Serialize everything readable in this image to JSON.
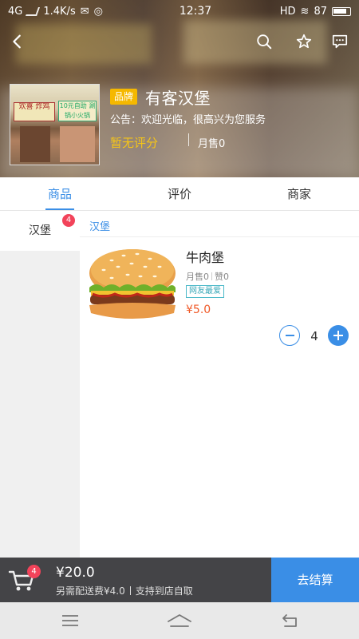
{
  "status_bar": {
    "network": "4G",
    "speed": "1.4K/s",
    "time": "12:37",
    "hd": "HD",
    "battery": "87"
  },
  "shop": {
    "brand_tag": "品牌",
    "name": "有客汉堡",
    "notice": "公告：欢迎光临，很高兴为您服务",
    "rating": "暂无评分",
    "monthly_sales": "月售0",
    "thumb_sign_left": "欢喜 炸鸡",
    "thumb_sign_right": "10元自助 涮锅小火锅"
  },
  "tabs": [
    {
      "label": "商品",
      "active": true
    },
    {
      "label": "评价",
      "active": false
    },
    {
      "label": "商家",
      "active": false
    }
  ],
  "categories": [
    {
      "label": "汉堡",
      "badge": "4",
      "selected": true
    }
  ],
  "section_title": "汉堡",
  "product": {
    "name": "牛肉堡",
    "monthly_sales": "月售0",
    "likes": "赞0",
    "tag": "网友最爱",
    "price": "¥5.0",
    "quantity": "4"
  },
  "cart": {
    "badge": "4",
    "total": "¥20.0",
    "delivery_fee": "另需配送费¥4.0",
    "pickup": "支持到店自取",
    "checkout_label": "去结算"
  },
  "colors": {
    "accent": "#3a8ee6",
    "price": "#f05a28",
    "brand_tag": "#f5b800",
    "badge": "#f2435a"
  }
}
